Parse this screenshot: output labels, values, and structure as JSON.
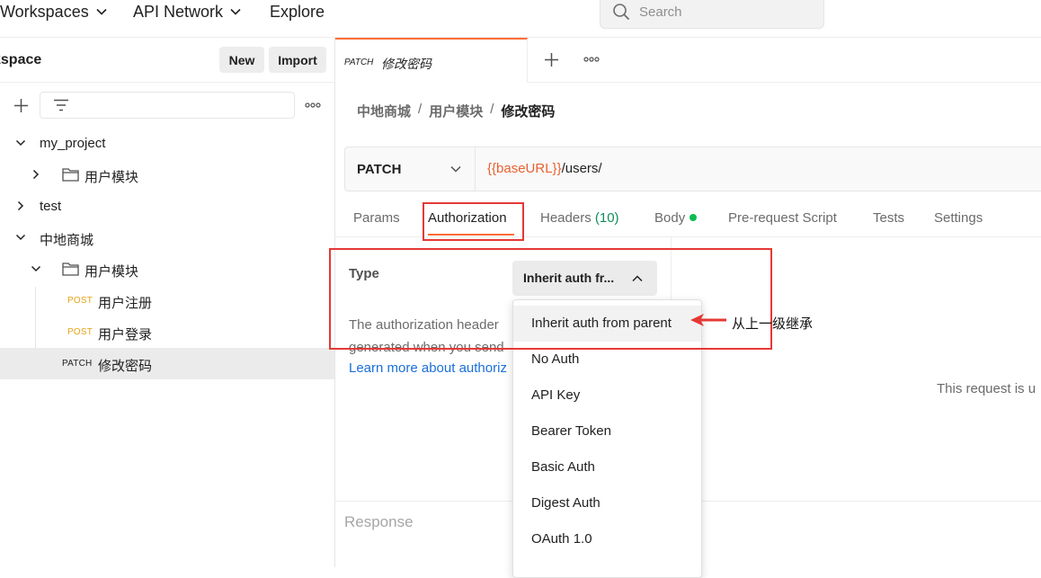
{
  "topbar": {
    "workspaces": "Workspaces",
    "api_network": "API Network",
    "explore": "Explore",
    "search_placeholder": "Search"
  },
  "sidebar": {
    "title": "kspace",
    "new_label": "New",
    "import_label": "Import",
    "tree": [
      {
        "label": "my_project",
        "expanded": true
      },
      {
        "label": "用户模块",
        "type": "folder",
        "expanded": false
      },
      {
        "label": "test",
        "expanded": false
      },
      {
        "label": "中地商城",
        "expanded": true
      },
      {
        "label": "用户模块",
        "type": "folder",
        "expanded": true
      },
      {
        "method": "POST",
        "label": "用户注册"
      },
      {
        "method": "POST",
        "label": "用户登录"
      },
      {
        "method": "PATCH",
        "label": "修改密码",
        "selected": true
      }
    ]
  },
  "tabs": {
    "active_method": "PATCH",
    "active_name": "修改密码"
  },
  "breadcrumb": [
    "中地商城",
    "用户模块",
    "修改密码"
  ],
  "breadcrumb_sep": "/",
  "request": {
    "method": "PATCH",
    "url_var": "{{baseURL}}",
    "url_path": "/users/"
  },
  "request_tabs": {
    "params": "Params",
    "authorization": "Authorization",
    "headers": "Headers",
    "headers_count": "(10)",
    "body": "Body",
    "pre_request": "Pre-request Script",
    "tests": "Tests",
    "settings": "Settings"
  },
  "auth": {
    "type_label": "Type",
    "selected_type": "Inherit auth fr...",
    "desc_line1": "The authorization header",
    "desc_line2": "generated when you send",
    "learn_more": "Learn more about authoriz",
    "options": [
      "Inherit auth from parent",
      "No Auth",
      "API Key",
      "Bearer Token",
      "Basic Auth",
      "Digest Auth",
      "OAuth 1.0"
    ],
    "right_info": "This request is u"
  },
  "response": {
    "label": "Response"
  },
  "annotation": {
    "text": "从上一级继承",
    "color": "#e53935"
  },
  "colors": {
    "accent": "#ff6c37",
    "post_method": "#e8a318",
    "url_variable": "#e8622f",
    "headers_count": "#0f8c5a",
    "body_dot": "#0cbb52",
    "link": "#1a6fd8"
  }
}
